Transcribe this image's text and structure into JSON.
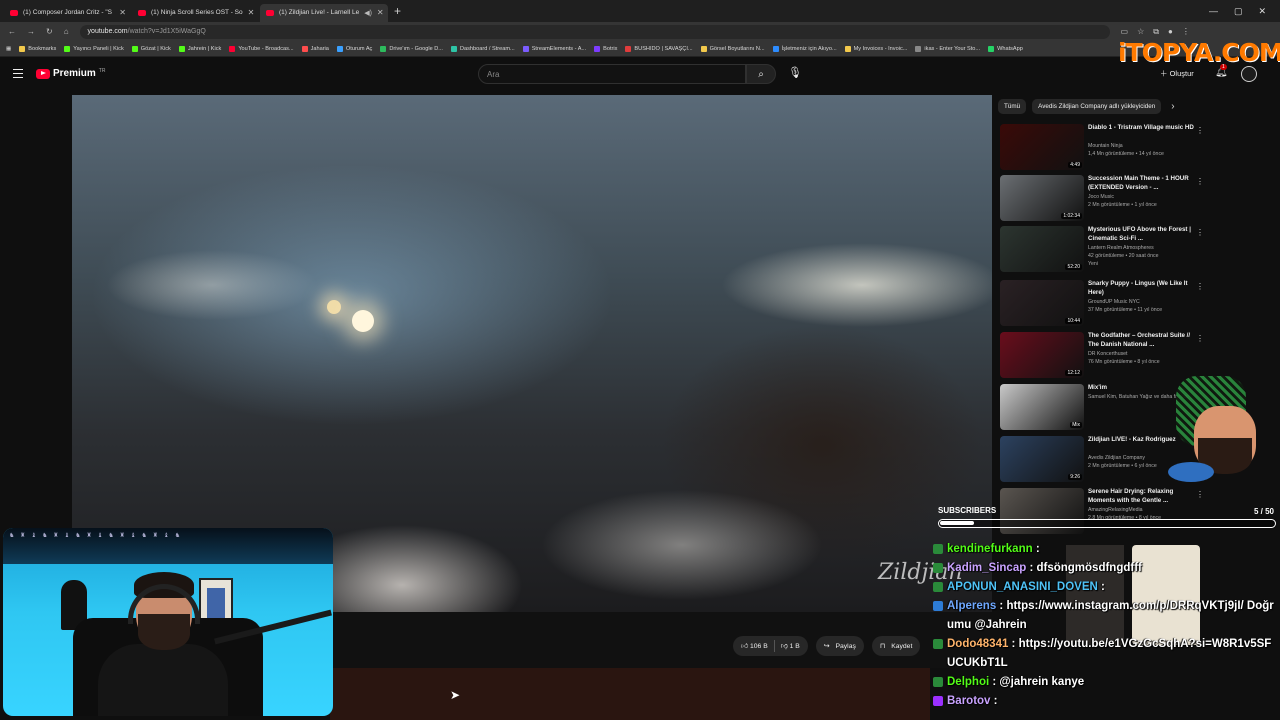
{
  "browser": {
    "tabs": [
      {
        "title": "(1) Composer Jordan Critz - \"S"
      },
      {
        "title": "(1) Ninja Scroll Series OST - So"
      },
      {
        "title": "(1) Zildjian Live! - Larnell Le"
      }
    ],
    "url_host": "youtube.com",
    "url_path": "/watch?v=Jd1X5iWaGgQ",
    "bookmarks": [
      {
        "label": "Bookmarks",
        "color": "#f2c94c"
      },
      {
        "label": "Yayıncı Paneli | Kick",
        "color": "#53fc18"
      },
      {
        "label": "Gözat | Kick",
        "color": "#53fc18"
      },
      {
        "label": "Jahrein | Kick",
        "color": "#53fc18"
      },
      {
        "label": "YouTube - Broadcas...",
        "color": "#ff0033"
      },
      {
        "label": "Jaharia",
        "color": "#ff4d4d"
      },
      {
        "label": "Oturum Aç",
        "color": "#3aa0ff"
      },
      {
        "label": "Drive'ım - Google D...",
        "color": "#2dbb5d"
      },
      {
        "label": "Dashboard / Stream...",
        "color": "#2ec4a6"
      },
      {
        "label": "StreamElements - A...",
        "color": "#7b5cff"
      },
      {
        "label": "Botrix",
        "color": "#7d3cff"
      },
      {
        "label": "BUSHIDO | SAVAŞÇI...",
        "color": "#e03c3c"
      },
      {
        "label": "Görsel Boyutlarını N...",
        "color": "#f2c94c"
      },
      {
        "label": "İşletmeniz için Akıyo...",
        "color": "#2d8cff"
      },
      {
        "label": "My Invoices - Invoic...",
        "color": "#f2c94c"
      },
      {
        "label": "ikas - Enter Your Sto...",
        "color": "#888888"
      },
      {
        "label": "WhatsApp",
        "color": "#25d366"
      }
    ]
  },
  "youtube": {
    "logo_label": "Premium",
    "logo_sup": "TR",
    "search_placeholder": "Ara",
    "create_label": "Oluştur",
    "notif_count": "1",
    "watermark": "iTOPYA.COM",
    "video_brand": "Zildjian",
    "actions": {
      "likes": "106 B",
      "dislikes": "1 B",
      "share": "Paylaş",
      "save": "Kaydet"
    },
    "chips": [
      "Tümü",
      "Avedis Zildjian Company adlı yükleyiciden"
    ],
    "related": [
      {
        "title": "Diablo 1 - Tristram Village music HD",
        "channel": "Mountain Ninja",
        "meta": "1,4 Mn görüntüleme • 14 yıl önce",
        "duration": "4:49",
        "color": "#3a0a08"
      },
      {
        "title": "Succession Main Theme - 1 HOUR (EXTENDED Version - ...",
        "channel": "Joco Music",
        "meta": "2 Mn görüntüleme • 1 yıl önce",
        "duration": "1:02:34",
        "color": "#6b6f73"
      },
      {
        "title": "Mysterious UFO Above the Forest | Cinematic Sci-Fi ...",
        "channel": "Lantern Realm Atmospheres",
        "meta": "42 görüntüleme • 20 saat önce",
        "badge": "Yeni",
        "duration": "52:20",
        "color": "#2c3530"
      },
      {
        "title": "Snarky Puppy - Lingus (We Like It Here)",
        "channel": "GroundUP Music NYC",
        "meta": "37 Mn görüntüleme • 11 yıl önce",
        "duration": "10:44",
        "color": "#2a2124"
      },
      {
        "title": "The Godfather – Orchestral Suite // The Danish National ...",
        "channel": "DR Koncerthuset",
        "meta": "76 Mn görüntüleme • 8 yıl önce",
        "duration": "12:12",
        "color": "#6a0d1c"
      },
      {
        "title": "Mix'im",
        "channel": "Samuel Kim, Batuhan Yağız ve daha fazlası",
        "meta": "",
        "duration": "Mix",
        "color": "#c9c9c9"
      },
      {
        "title": "Zildjian LIVE! - Kaz Rodriguez",
        "channel": "Avedis Zildjian Company",
        "meta": "2 Mn görüntüleme • 6 yıl önce",
        "duration": "9:26",
        "color": "#2c4260"
      },
      {
        "title": "Serene Hair Drying: Relaxing Moments with the Gentle ...",
        "channel": "AmazingRelaxingMedia",
        "meta": "2,8 Mn görüntüleme • 8 yıl önce",
        "duration": "",
        "color": "#5a5550"
      }
    ]
  },
  "overlay": {
    "subs_label": "SUBSCRIBERS",
    "subs_count": "5 / 50",
    "subs_progress": 0.1,
    "chat": [
      {
        "user": "kendinefurkann",
        "user_color": "#53fc18",
        "badge": "#2a8a3a",
        "text": ""
      },
      {
        "user": "Kadim_Sincap",
        "user_color": "#c9a3ff",
        "badge": "#2a8a3a",
        "text": "dfsöngmösdfngdfff"
      },
      {
        "user": "APONUN_ANASINI_DOVEN",
        "user_color": "#4fc3f7",
        "badge": "#2a8a3a",
        "text": ""
      },
      {
        "user": "Alperens",
        "user_color": "#6fa8ff",
        "badge": "#2d7cd6",
        "text": "https://www.instagram.com/p/DRRqVKTj9jI/ Doğrumu @Jahrein"
      },
      {
        "user": "Dodo48341",
        "user_color": "#ffb46b",
        "badge": "#2a8a3a",
        "text": "https://youtu.be/e1VGzGcSqhA?si=W8R1v5SFUCUKbT1L"
      },
      {
        "user": "Delphoi",
        "user_color": "#53fc18",
        "badge": "#2a8a3a",
        "text": "@jahrein kanye"
      },
      {
        "user": "Barotov",
        "user_color": "#c9a3ff",
        "badge": "#9b30ff",
        "text": ""
      }
    ]
  }
}
